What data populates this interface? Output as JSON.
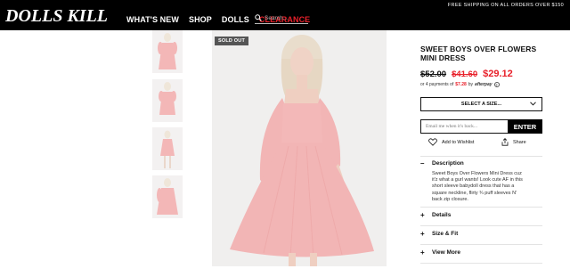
{
  "header": {
    "logo_text": "DOLLS KILL",
    "nav": [
      "WHAT'S NEW",
      "SHOP",
      "DOLLS",
      "CLEARANCE"
    ],
    "search_placeholder": "Search...",
    "shipping_banner": "FREE SHIPPING ON ALL ORDERS OVER $150"
  },
  "gallery": {
    "thumbnail_count": 4,
    "sold_out_badge": "SOLD OUT"
  },
  "product": {
    "title": "SWEET BOYS OVER FLOWERS MINI DRESS",
    "price_original": "$52.00",
    "price_previous": "$41.60",
    "price_sale": "$29.12",
    "afterpay_prefix": "or 4 payments of",
    "afterpay_amount": "$7.28",
    "afterpay_by": "by",
    "afterpay_brand": "afterpay",
    "size_select": "SELECT A SIZE...",
    "notify_placeholder": "Email me when it's back...",
    "notify_button": "ENTER",
    "wishlist_label": "Add to Wishlist",
    "share_label": "Share",
    "description_heading": "Description",
    "description_text": "Sweet Boys Over Flowers Mini Dress cuz it'z what a gurl wants! Look cute AF in this short sleeve babydoll dress that has a square neckline, flirty ¾ puff sleeves N' back zip closure.",
    "sections": [
      "Details",
      "Size & Fit",
      "View More"
    ]
  },
  "colors": {
    "header_bg": "#000000",
    "sale_red": "#e8202a",
    "dress_pink": "#f2b5b5"
  }
}
